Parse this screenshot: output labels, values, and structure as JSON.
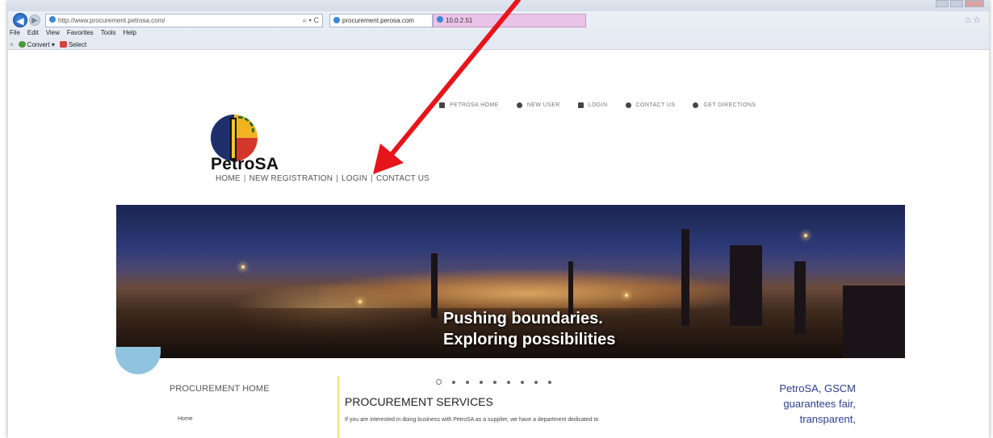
{
  "browser": {
    "address": "http://www.procurement.petrosa.com/",
    "address_controls": "⌕ ▾ C",
    "tab_active": "procurement.perosa.com",
    "tab_inactive": "10.0.2.51",
    "menu": [
      "File",
      "Edit",
      "View",
      "Favorites",
      "Tools",
      "Help"
    ],
    "toolbar": {
      "close": "×",
      "convert_label": "Convert",
      "convert_caret": "▾",
      "select_label": "Select"
    },
    "right_icons": "⌂ ☆"
  },
  "site": {
    "brand": "PetroSA",
    "subnav": [
      "HOME",
      "NEW REGISTRATION",
      "LOGIN",
      "CONTACT US"
    ],
    "subnav_sep": "|",
    "topnav": [
      {
        "label": "PETROSA HOME",
        "icon": "home-icon"
      },
      {
        "label": "NEW USER",
        "icon": "user-icon"
      },
      {
        "label": "LOGIN",
        "icon": "lock-icon"
      },
      {
        "label": "CONTACT US",
        "icon": "headset-icon"
      },
      {
        "label": "GET DIRECTIONS",
        "icon": "map-pin-icon"
      }
    ],
    "banner": {
      "line1": "Pushing boundaries.",
      "line2": "Exploring possibilities"
    },
    "left": {
      "title": "PROCUREMENT HOME",
      "link": "Home"
    },
    "main": {
      "title": "PROCUREMENT SERVICES",
      "text": "If you are interested in doing business with PetroSA as a supplier, we have a department dedicated to"
    },
    "right": {
      "line1": "PetroSA, GSCM",
      "line2": "guarantees fair,",
      "line3": "transparent,"
    }
  },
  "colors": {
    "arrow": "#e8141b",
    "right_text": "#2b3f8a",
    "divider": "#efd78a"
  }
}
